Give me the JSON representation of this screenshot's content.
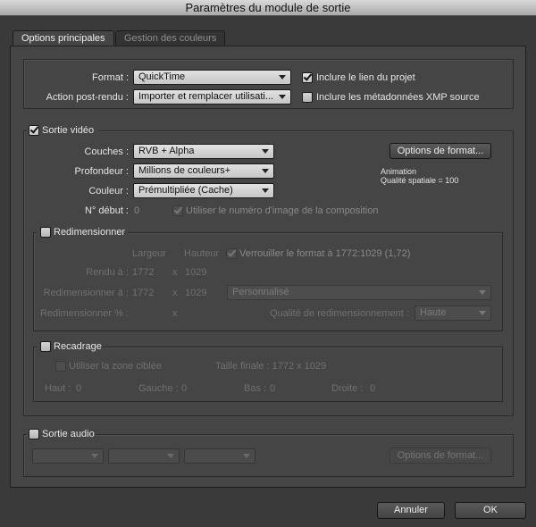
{
  "window": {
    "title": "Paramètres du module de sortie"
  },
  "tabs": [
    "Options principales",
    "Gestion des couleurs"
  ],
  "top": {
    "format_label": "Format :",
    "format_value": "QuickTime",
    "post_render_label": "Action post-rendu :",
    "post_render_value": "Importer et remplacer utilisati...",
    "include_project_link": "Inclure le lien du projet",
    "include_xmp": "Inclure les métadonnées XMP source"
  },
  "video": {
    "section_label": "Sortie vidéo",
    "channels_label": "Couches :",
    "channels_value": "RVB + Alpha",
    "depth_label": "Profondeur :",
    "depth_value": "Millions de couleurs+",
    "color_label": "Couleur :",
    "color_value": "Prémultipliée (Cache)",
    "start_label": "N° début :",
    "start_value": "0",
    "use_comp_frame": "Utiliser le numéro d'image de la composition",
    "format_options_button": "Options de format...",
    "codec_info_1": "Animation",
    "codec_info_2": "Qualité spatiale = 100"
  },
  "resize": {
    "section_label": "Redimensionner",
    "col_width": "Largeur",
    "col_height": "Hauteur",
    "lock_ratio": "Verrouiller le format à 1772:1029 (1,72)",
    "rendered_at_label": "Rendu à :",
    "rendered_w": "1772",
    "rendered_x": "x",
    "rendered_h": "1029",
    "resize_to_label": "Redimensionner à :",
    "resize_w": "1772",
    "resize_x": "x",
    "resize_h": "1029",
    "preset_value": "Personnalisé",
    "resize_pct_label": "Redimensionner % :",
    "resize_pct_x": "x",
    "quality_label": "Qualité de redimensionnement :",
    "quality_value": "Haute"
  },
  "crop": {
    "section_label": "Recadrage",
    "use_roi": "Utiliser la zone ciblée",
    "final_size": "Taille finale : 1772 x 1029",
    "top_label": "Haut :",
    "top_value": "0",
    "left_label": "Gauche :",
    "left_value": "0",
    "bottom_label": "Bas :",
    "bottom_value": "0",
    "right_label": "Droite :",
    "right_value": "0"
  },
  "audio": {
    "section_label": "Sortie audio",
    "format_options_button": "Options de format..."
  },
  "footer": {
    "cancel": "Annuler",
    "ok": "OK"
  }
}
